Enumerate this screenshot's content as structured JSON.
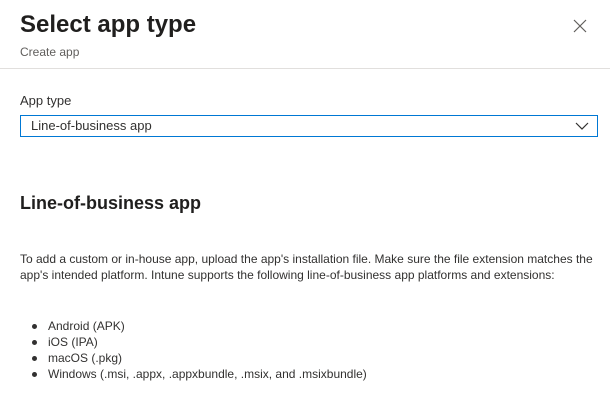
{
  "header": {
    "title": "Select app type",
    "subtitle": "Create app",
    "close_icon": "close-icon"
  },
  "app_type_field": {
    "label": "App type",
    "selected_value": "Line-of-business app",
    "chevron_icon": "chevron-down-icon",
    "focus_color": "#0078d4"
  },
  "section": {
    "heading": "Line-of-business app",
    "description": "To add a custom or in-house app, upload the app's installation file. Make sure the file extension matches the app's intended platform. Intune supports the following line-of-business app platforms and extensions:",
    "platforms": [
      "Android (APK)",
      "iOS (IPA)",
      "macOS (.pkg)",
      "Windows (.msi, .appx, .appxbundle, .msix, and .msixbundle)"
    ]
  }
}
